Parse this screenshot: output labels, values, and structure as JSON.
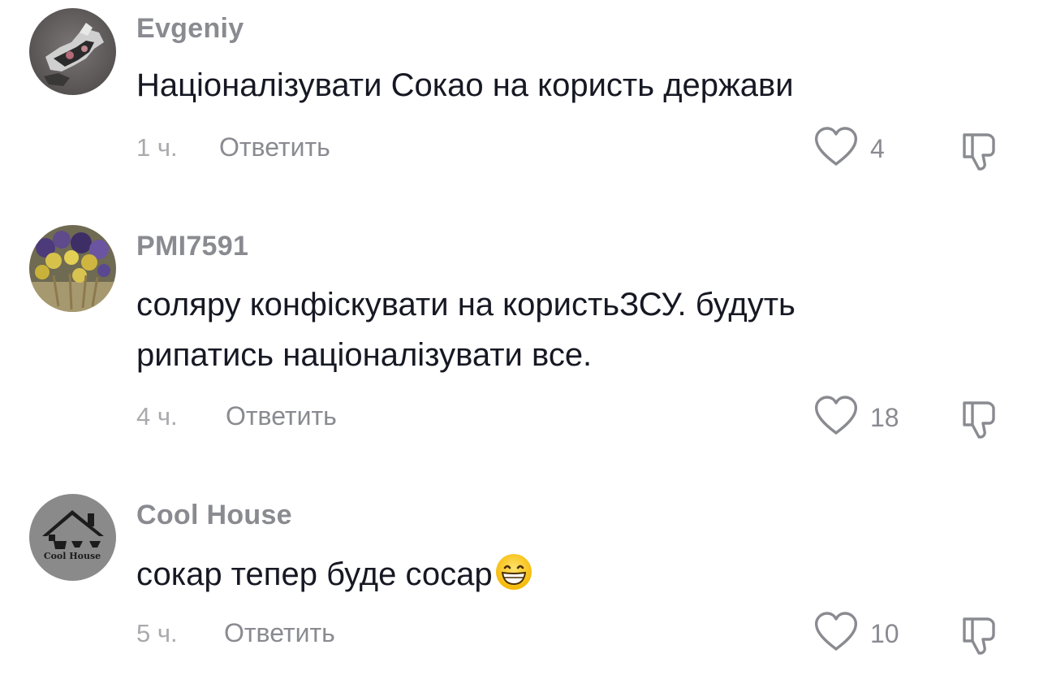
{
  "comments": [
    {
      "username": "Evgeniy",
      "text": "Націоналізувати Сокао на користь держави",
      "time": "1 ч.",
      "reply_label": "Ответить",
      "likes": "4",
      "avatar": "avatar-photo-gray-sculpture"
    },
    {
      "username": "PMI7591",
      "text_lines": [
        "соляру конфіскувати на користьЗСУ. будуть",
        "рипатись націоналізувати все."
      ],
      "time": "4 ч.",
      "reply_label": "Ответить",
      "likes": "18",
      "avatar": "avatar-photo-dried-flowers"
    },
    {
      "username": "Cool House",
      "text": "сокар тепер буде сосар",
      "emoji": "grinning-face-emoji",
      "time": "5 ч.",
      "reply_label": "Ответить",
      "likes": "10",
      "avatar_text": "Cool House"
    }
  ],
  "icons": {
    "like": "heart-outline-icon",
    "dislike": "thumbs-down-outline-icon"
  },
  "colors": {
    "username": "#8a8b91",
    "text": "#161823",
    "meta": "#a9aaae"
  }
}
